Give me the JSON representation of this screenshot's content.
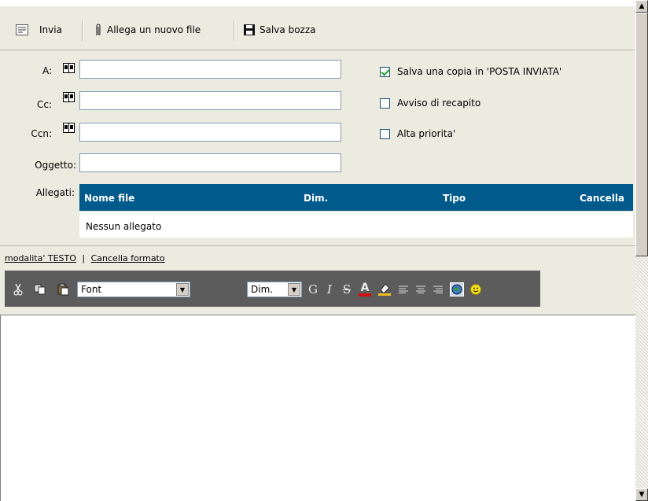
{
  "toolbar": {
    "send_label": "Invia",
    "attach_label": "Allega un nuovo file",
    "save_draft_label": "Salva bozza"
  },
  "fields": {
    "to_label": "A:",
    "cc_label": "Cc:",
    "bcc_label": "Ccn:",
    "subject_label": "Oggetto:",
    "to_value": "",
    "cc_value": "",
    "bcc_value": "",
    "subject_value": ""
  },
  "options": [
    {
      "label": "Salva una copia in 'POSTA INVIATA'",
      "checked": true
    },
    {
      "label": "Avviso di recapito",
      "checked": false
    },
    {
      "label": "Alta priorita'",
      "checked": false
    }
  ],
  "attachments": {
    "label": "Allegati:",
    "columns": [
      "Nome file",
      "Dim.",
      "Tipo",
      "Cancella"
    ],
    "empty_text": "Nessun allegato"
  },
  "mode_links": {
    "text_mode": "modalita' TESTO",
    "clear_format": "Cancella formato"
  },
  "format_toolbar": {
    "font_value": "Font",
    "size_value": "Dim.",
    "bold": "G",
    "italic": "I",
    "strike": "S",
    "forecolor": "A"
  },
  "editor": {
    "body": ""
  }
}
